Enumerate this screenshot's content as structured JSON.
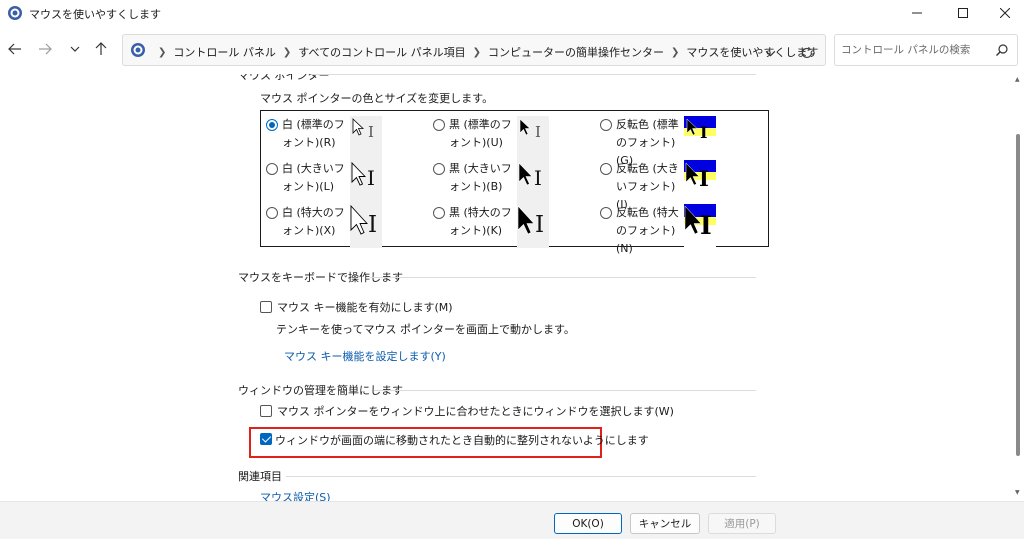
{
  "window": {
    "title": "マウスを使いやすくします"
  },
  "address": {
    "crumbs": [
      "コントロール パネル",
      "すべてのコントロール パネル項目",
      "コンピューターの簡単操作センター",
      "マウスを使いやすくします"
    ]
  },
  "search": {
    "placeholder": "コントロール パネルの検索"
  },
  "pointers": {
    "group_title": "マウス ポインター",
    "description": "マウス ポインターの色とサイズを変更します。",
    "options": [
      {
        "label": "白 (標準のフォント)(R)",
        "selected": true
      },
      {
        "label": "黒 (標準のフォント)(U)",
        "selected": false
      },
      {
        "label": "反転色 (標準のフォント)(G)",
        "selected": false
      },
      {
        "label": "白 (大きいフォント)(L)",
        "selected": false
      },
      {
        "label": "黒 (大きいフォント)(B)",
        "selected": false
      },
      {
        "label": "反転色 (大きいフォント)(I)",
        "selected": false
      },
      {
        "label": "白 (特大のフォント)(X)",
        "selected": false
      },
      {
        "label": "黒 (特大のフォント)(K)",
        "selected": false
      },
      {
        "label": "反転色 (特大のフォント)(N)",
        "selected": false
      }
    ]
  },
  "keyboard": {
    "group_title": "マウスをキーボードで操作します",
    "checkbox_label": "マウス キー機能を有効にします(M)",
    "checkbox_checked": false,
    "description": "テンキーを使ってマウス ポインターを画面上で動かします。",
    "link": "マウス キー機能を設定します(Y)"
  },
  "window_mgmt": {
    "group_title": "ウィンドウの管理を簡単にします",
    "hover_label": "マウス ポインターをウィンドウ上に合わせたときにウィンドウを選択します(W)",
    "hover_checked": false,
    "snap_label": "ウィンドウが画面の端に移動されたとき自動的に整列されないようにします",
    "snap_checked": true
  },
  "related": {
    "group_title": "関連項目",
    "link": "マウス設定(S)"
  },
  "footer": {
    "ok": "OK(O)",
    "cancel": "キャンセル",
    "apply": "適用(P)"
  },
  "colors": {
    "accent": "#0067c0",
    "link": "#0b5cad",
    "highlight": "#e0201b"
  }
}
